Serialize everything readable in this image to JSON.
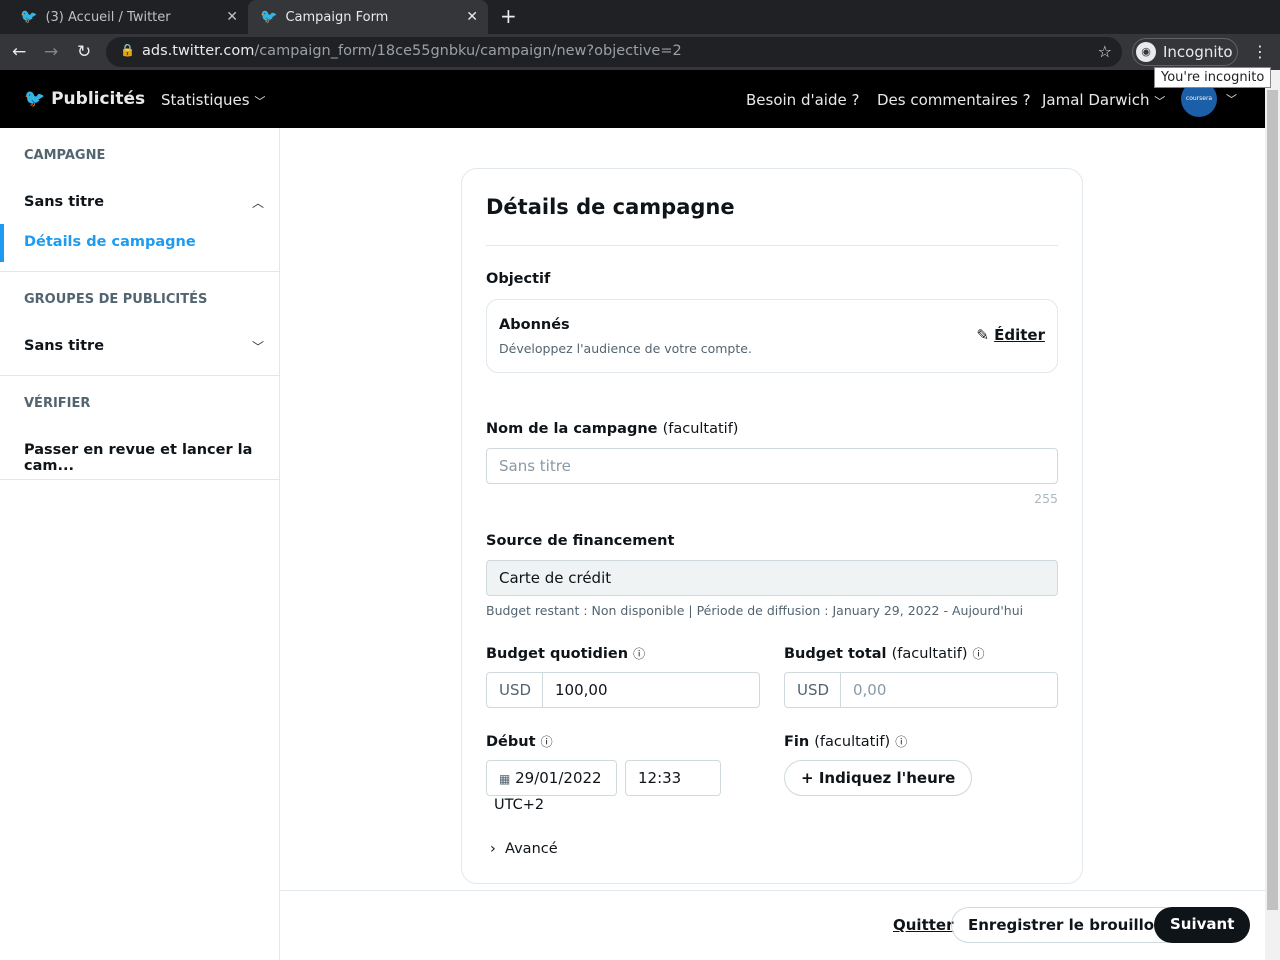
{
  "browser": {
    "tabs": [
      {
        "title": "(3) Accueil / Twitter"
      },
      {
        "title": "Campaign Form"
      }
    ],
    "url_host": "ads.twitter.com",
    "url_path": "/campaign_form/18ce55gnbku/campaign/new?objective=2",
    "incognito": "Incognito",
    "tooltip": "You're incognito"
  },
  "header": {
    "logo": "Publicités",
    "stats": "Statistiques",
    "help": "Besoin d'aide ?",
    "feedback": "Des commentaires ?",
    "user": "Jamal Darwich",
    "avatar": "coursera"
  },
  "sidebar": {
    "campaign_section": "CAMPAGNE",
    "campaign_name": "Sans titre",
    "campaign_details": "Détails de campagne",
    "adgroups_section": "GROUPES DE PUBLICITÉS",
    "adgroup_name": "Sans titre",
    "verify_section": "VÉRIFIER",
    "review": "Passer en revue et lancer la cam..."
  },
  "form": {
    "title": "Détails de campagne",
    "objective_label": "Objectif",
    "objective_name": "Abonnés",
    "objective_desc": "Développez l'audience de votre compte.",
    "edit": "Éditer",
    "name_label": "Nom de la campagne",
    "optional": "(facultatif)",
    "name_placeholder": "Sans titre",
    "name_counter": "255",
    "funding_label": "Source de financement",
    "funding_value": "Carte de crédit",
    "funding_info": "Budget restant : Non disponible | Période de diffusion : January 29, 2022 - Aujourd'hui",
    "daily_label": "Budget quotidien",
    "currency": "USD",
    "daily_value": "100,00",
    "total_label": "Budget total",
    "total_placeholder": "0,00",
    "start_label": "Début",
    "start_date": "29/01/2022",
    "start_time": "12:33",
    "timezone": "UTC+2",
    "end_label": "Fin",
    "end_button": "Indiquez l'heure",
    "advanced": "Avancé"
  },
  "footer": {
    "quit": "Quitter",
    "save_draft": "Enregistrer le brouillon",
    "next": "Suivant"
  }
}
